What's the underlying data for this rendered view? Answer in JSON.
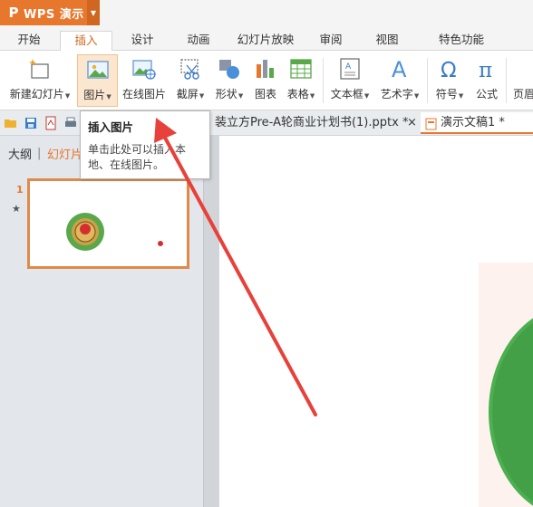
{
  "app": {
    "logo": "P",
    "name": "WPS 演示"
  },
  "menu": {
    "tabs": [
      {
        "label": "开始"
      },
      {
        "label": "插入",
        "active": true
      },
      {
        "label": "设计"
      },
      {
        "label": "动画"
      },
      {
        "label": "幻灯片放映"
      },
      {
        "label": "审阅"
      },
      {
        "label": "视图"
      },
      {
        "label": "特色功能"
      }
    ]
  },
  "ribbon": {
    "items": [
      {
        "label": "新建幻灯片",
        "icon": "new-slide-icon",
        "dropdown": true
      },
      {
        "label": "图片",
        "icon": "picture-icon",
        "dropdown": true,
        "hovered": true
      },
      {
        "label": "在线图片",
        "icon": "online-picture-icon",
        "dropdown": false
      },
      {
        "label": "截屏",
        "icon": "screenshot-icon",
        "dropdown": true
      },
      {
        "label": "形状",
        "icon": "shapes-icon",
        "dropdown": true
      },
      {
        "label": "图表",
        "icon": "chart-icon",
        "dropdown": false
      },
      {
        "label": "表格",
        "icon": "table-icon",
        "dropdown": true
      },
      {
        "label": "文本框",
        "icon": "textbox-icon",
        "dropdown": true
      },
      {
        "label": "艺术字",
        "icon": "wordart-icon",
        "dropdown": true
      },
      {
        "label": "符号",
        "icon": "symbol-icon",
        "dropdown": true
      },
      {
        "label": "公式",
        "icon": "formula-icon",
        "dropdown": false
      },
      {
        "label": "页眉",
        "icon": "header-icon",
        "dropdown": false
      }
    ],
    "dropdown_glyph": "▼"
  },
  "tooltip": {
    "title": "插入图片",
    "body": "单击此处可以插入本地、在线图片。"
  },
  "doc_tabs": {
    "items": [
      {
        "label": "装立方Pre-A轮商业计划书(1).pptx *",
        "active": false
      },
      {
        "label": "演示文稿1 *",
        "active": true
      }
    ],
    "close_glyph": "×"
  },
  "left_pane": {
    "tabs": [
      {
        "label": "大纲",
        "active": false
      },
      {
        "label": "幻灯片",
        "active": true
      }
    ],
    "separator": "|",
    "slide_number": "1",
    "slide_star": "★"
  },
  "colors": {
    "accent": "#e8772e",
    "annotation_arrow": "#e8403a",
    "ribbon_hover": "#fbe6cf"
  }
}
